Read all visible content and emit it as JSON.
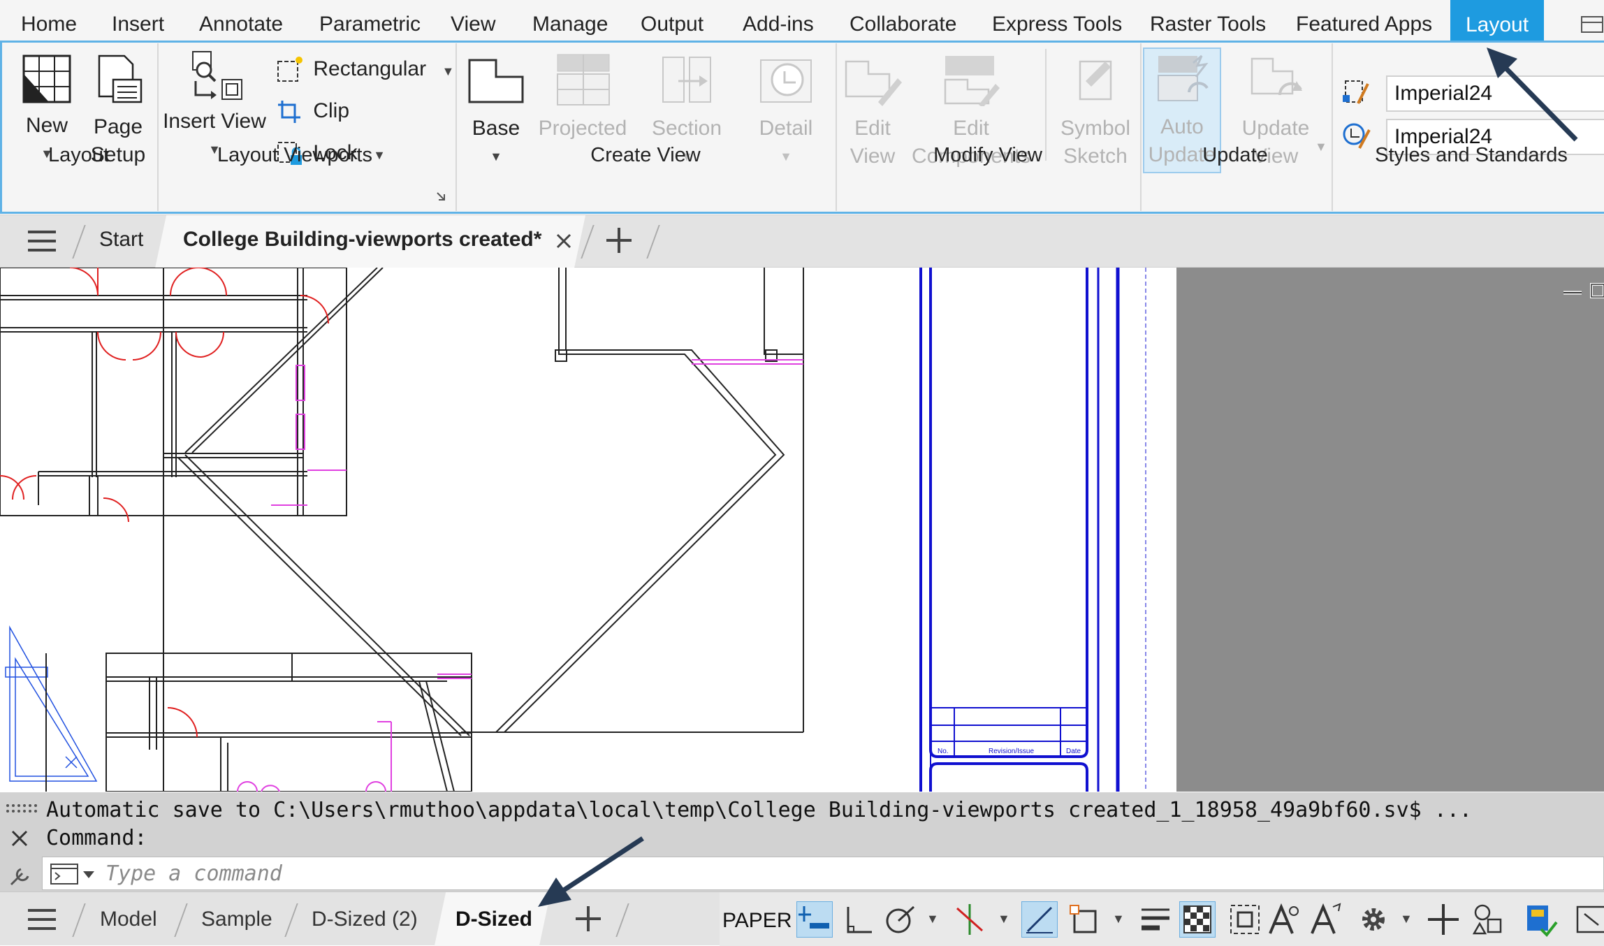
{
  "ribbon_tabs": [
    {
      "label": "Home"
    },
    {
      "label": "Insert"
    },
    {
      "label": "Annotate"
    },
    {
      "label": "Parametric"
    },
    {
      "label": "View"
    },
    {
      "label": "Manage"
    },
    {
      "label": "Output"
    },
    {
      "label": "Add-ins"
    },
    {
      "label": "Collaborate"
    },
    {
      "label": "Express Tools"
    },
    {
      "label": "Raster Tools"
    },
    {
      "label": "Featured Apps"
    },
    {
      "label": "Layout"
    }
  ],
  "active_tab": "Layout",
  "panels": {
    "layout": {
      "title": "Layout",
      "new_label": "New",
      "page_setup_label_1": "Page",
      "page_setup_label_2": "Setup"
    },
    "layout_viewports": {
      "title": "Layout Viewports",
      "insert_view_label": "Insert View",
      "rectangular_label": "Rectangular",
      "clip_label": "Clip",
      "lock_label": "Lock"
    },
    "create_view": {
      "title": "Create View",
      "base_label": "Base",
      "projected_label": "Projected",
      "section_label": "Section",
      "detail_label": "Detail"
    },
    "modify_view": {
      "title": "Modify View",
      "edit_view_1": "Edit",
      "edit_view_2": "View",
      "edit_components_1": "Edit",
      "edit_components_2": "Components",
      "symbol_sketch_1": "Symbol",
      "symbol_sketch_2": "Sketch"
    },
    "update": {
      "title": "Update",
      "auto_update_1": "Auto",
      "auto_update_2": "Update",
      "update_view_1": "Update",
      "update_view_2": "View"
    },
    "styles": {
      "title": "Styles and Standards",
      "style_1": "Imperial24",
      "style_2": "Imperial24"
    }
  },
  "file_tabs": {
    "start": "Start",
    "active": "College Building-viewports created*"
  },
  "command": {
    "history_1": "Automatic save to C:\\Users\\rmuthoo\\appdata\\local\\temp\\College Building-viewports created_1_18958_49a9bf60.sv$ ...",
    "history_2": "Command:",
    "placeholder": "Type a command"
  },
  "layout_tabs": [
    {
      "label": "Model"
    },
    {
      "label": "Sample"
    },
    {
      "label": "D-Sized (2)"
    },
    {
      "label": "D-Sized"
    }
  ],
  "active_layout": "D-Sized",
  "status": {
    "space": "PAPER"
  },
  "title_block": {
    "col_no": "No.",
    "col_rev": "Revision/Issue",
    "col_date": "Date"
  },
  "colors": {
    "accent": "#1e9be0",
    "ribbon_border": "#5fb2e6",
    "paper_grey": "#8c8c8c",
    "arrow": "#263a54"
  }
}
